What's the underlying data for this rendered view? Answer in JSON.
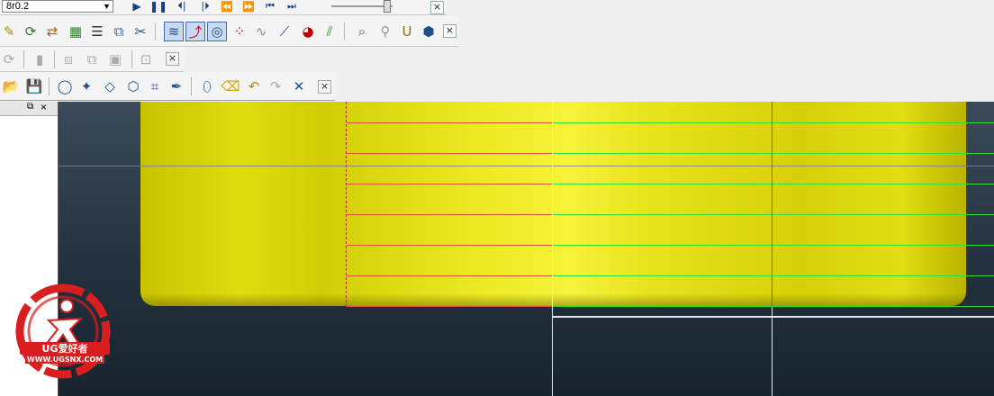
{
  "toolbar1": {
    "combo_value": "8r0.2",
    "close_label": "×"
  },
  "toolbar2": {
    "close_label": "×"
  },
  "toolbar3": {
    "close_label": "×"
  },
  "toolbar4": {
    "close_label": "×"
  },
  "panel": {
    "restore_label": "⧉",
    "close_label": "×"
  },
  "watermark": {
    "brand": "UG爱好者",
    "url": "WWW.UGSNX.COM"
  },
  "icons": [
    "play-icon",
    "pause-icon",
    "step-back-icon",
    "step-forward-icon",
    "rewind-icon",
    "fast-forward-icon",
    "skip-start-icon",
    "skip-end-icon",
    "open-folder-icon",
    "save-icon",
    "lasso-icon",
    "select-icon",
    "diamond-icon",
    "box-icon",
    "drafting-icon",
    "pen-icon",
    "eraser-icon",
    "undo-icon",
    "redo-icon",
    "delete-icon",
    "surface-icon",
    "view-icon",
    "layer-icon",
    "table-icon",
    "copy-icon",
    "cut-icon",
    "refresh-icon",
    "magnify-icon",
    "pin-icon",
    "tool-icon"
  ]
}
